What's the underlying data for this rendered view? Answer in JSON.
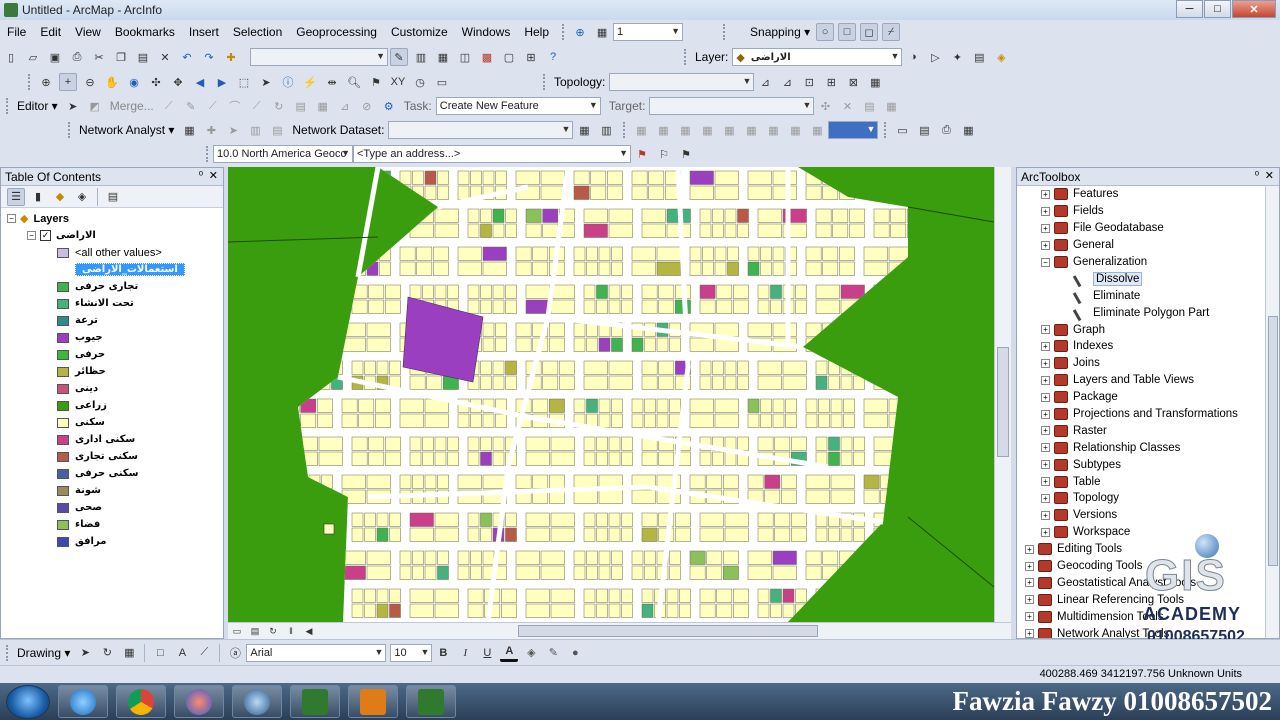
{
  "window": {
    "title": "Untitled - ArcMap - ArcInfo",
    "min": "─",
    "max": "□",
    "close": "✕"
  },
  "menubar": {
    "items": [
      "File",
      "Edit",
      "View",
      "Bookmarks",
      "Insert",
      "Selection",
      "Geoprocessing",
      "Customize",
      "Windows",
      "Help"
    ]
  },
  "toolbars": {
    "scale_value": "1",
    "snapping_label": "Snapping ▾",
    "layer_label": "Layer:",
    "layer_value": "الاراضى",
    "topology_label": "Topology:",
    "editor_label": "Editor ▾",
    "merge_label": "Merge...",
    "task_label": "Task:",
    "task_value": "Create New Feature",
    "target_label": "Target:",
    "network_analyst_label": "Network Analyst ▾",
    "network_dataset_label": "Network Dataset:",
    "geocoder_value": "10.0 North America Geocc",
    "address_placeholder": "<Type an address...>"
  },
  "toc": {
    "title": "Table Of Contents",
    "pin": "ᵒ",
    "close": "✕",
    "layers_label": "Layers",
    "layer_name": "الاراضى",
    "legend": [
      {
        "label": "<all other values>",
        "color": "#c9bde6"
      },
      {
        "label": "استعمالات_الاراضى",
        "color": null,
        "selected": true
      },
      {
        "label": "تجارى حرفى",
        "color": "#3fb34f"
      },
      {
        "label": "تحت الانشاء",
        "color": "#45b27e"
      },
      {
        "label": "ترعة",
        "color": "#2f8c8c"
      },
      {
        "label": "جيوب",
        "color": "#9a3fbf"
      },
      {
        "label": "حرفى",
        "color": "#3ab83a"
      },
      {
        "label": "حظائر",
        "color": "#b5b544"
      },
      {
        "label": "دينى",
        "color": "#c9507a"
      },
      {
        "label": "زراعى",
        "color": "#3a9d0e"
      },
      {
        "label": "سكنى",
        "color": "#ffffc0"
      },
      {
        "label": "سكنى ادارى",
        "color": "#c93f8a"
      },
      {
        "label": "سكنى تجارى",
        "color": "#b85a4a"
      },
      {
        "label": "سكنى حرفى",
        "color": "#4a5fa0"
      },
      {
        "label": "شونة",
        "color": "#9b8a5a"
      },
      {
        "label": "صحى",
        "color": "#5a4aa6"
      },
      {
        "label": "فضاء",
        "color": "#8cc05a"
      },
      {
        "label": "مرافق",
        "color": "#3a4ab0"
      }
    ]
  },
  "toolbox": {
    "title": "ArcToolbox",
    "pin": "ᵒ",
    "close": "✕",
    "items": [
      {
        "label": "Features",
        "indent": 2,
        "type": "box",
        "exp": "+"
      },
      {
        "label": "Fields",
        "indent": 2,
        "type": "box",
        "exp": "+"
      },
      {
        "label": "File Geodatabase",
        "indent": 2,
        "type": "box",
        "exp": "+"
      },
      {
        "label": "General",
        "indent": 2,
        "type": "box",
        "exp": "+"
      },
      {
        "label": "Generalization",
        "indent": 2,
        "type": "box",
        "exp": "−"
      },
      {
        "label": "Dissolve",
        "indent": 3,
        "type": "tool",
        "selected": true
      },
      {
        "label": "Eliminate",
        "indent": 3,
        "type": "tool"
      },
      {
        "label": "Eliminate Polygon Part",
        "indent": 3,
        "type": "tool"
      },
      {
        "label": "Graph",
        "indent": 2,
        "type": "box",
        "exp": "+"
      },
      {
        "label": "Indexes",
        "indent": 2,
        "type": "box",
        "exp": "+"
      },
      {
        "label": "Joins",
        "indent": 2,
        "type": "box",
        "exp": "+"
      },
      {
        "label": "Layers and Table Views",
        "indent": 2,
        "type": "box",
        "exp": "+"
      },
      {
        "label": "Package",
        "indent": 2,
        "type": "box",
        "exp": "+"
      },
      {
        "label": "Projections and Transformations",
        "indent": 2,
        "type": "box",
        "exp": "+"
      },
      {
        "label": "Raster",
        "indent": 2,
        "type": "box",
        "exp": "+"
      },
      {
        "label": "Relationship Classes",
        "indent": 2,
        "type": "box",
        "exp": "+"
      },
      {
        "label": "Subtypes",
        "indent": 2,
        "type": "box",
        "exp": "+"
      },
      {
        "label": "Table",
        "indent": 2,
        "type": "box",
        "exp": "+"
      },
      {
        "label": "Topology",
        "indent": 2,
        "type": "box",
        "exp": "+"
      },
      {
        "label": "Versions",
        "indent": 2,
        "type": "box",
        "exp": "+"
      },
      {
        "label": "Workspace",
        "indent": 2,
        "type": "box",
        "exp": "+"
      },
      {
        "label": "Editing Tools",
        "indent": 1,
        "type": "box",
        "exp": "+"
      },
      {
        "label": "Geocoding Tools",
        "indent": 1,
        "type": "box",
        "exp": "+"
      },
      {
        "label": "Geostatistical Analyst Tools",
        "indent": 1,
        "type": "box",
        "exp": "+"
      },
      {
        "label": "Linear Referencing Tools",
        "indent": 1,
        "type": "box",
        "exp": "+"
      },
      {
        "label": "Multidimension Tools",
        "indent": 1,
        "type": "box",
        "exp": "+"
      },
      {
        "label": "Network Analyst Tools",
        "indent": 1,
        "type": "box",
        "exp": "+"
      }
    ]
  },
  "drawing": {
    "label": "Drawing ▾",
    "font": "Arial",
    "font_size": "10",
    "bold": "B",
    "italic": "I",
    "underline": "U"
  },
  "status": {
    "coords": "400288.469  3412197.756 Unknown Units"
  },
  "watermark": {
    "logo": "GIS",
    "academy": "ACADEMY",
    "phone": "01008657502"
  },
  "banner": {
    "text": "Fawzia Fawzy 01008657502"
  },
  "colors": {
    "map_bg": "#3a9d0e",
    "parcel": "#ffffc0",
    "road": "#ffffff"
  }
}
